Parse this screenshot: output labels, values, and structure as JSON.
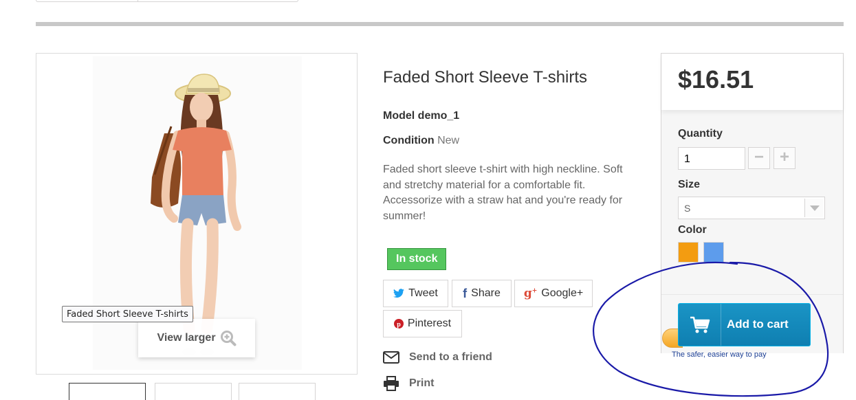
{
  "product": {
    "title": "Faded Short Sleeve T-shirts",
    "model_label": "Model",
    "model_value": "demo_1",
    "condition_label": "Condition",
    "condition_value": "New",
    "description": "Faded short sleeve t-shirt with high neckline. Soft and stretchy material for a comfortable fit. Accessorize with a straw hat and you're ready for summer!",
    "stock_status": "In stock"
  },
  "image": {
    "tooltip": "Faded Short Sleeve T-shirts",
    "view_larger": "View larger",
    "thumbnails_count": 3
  },
  "social": {
    "tweet": "Tweet",
    "share": "Share",
    "google": "Google+",
    "pinterest": "Pinterest"
  },
  "actions": {
    "send_to_friend": "Send to a friend",
    "print": "Print"
  },
  "buy_box": {
    "price": "$16.51",
    "quantity_label": "Quantity",
    "quantity_value": "1",
    "size_label": "Size",
    "size_value": "S",
    "color_label": "Color",
    "colors": [
      "#f39c11",
      "#5d9cec"
    ],
    "add_to_cart": "Add to cart",
    "paypal_tagline": "The safer, easier way to pay"
  },
  "colors": {
    "in_stock": "#55c65e",
    "cart_button": "#1590c3",
    "annotation_ink": "#1a1aa8"
  }
}
